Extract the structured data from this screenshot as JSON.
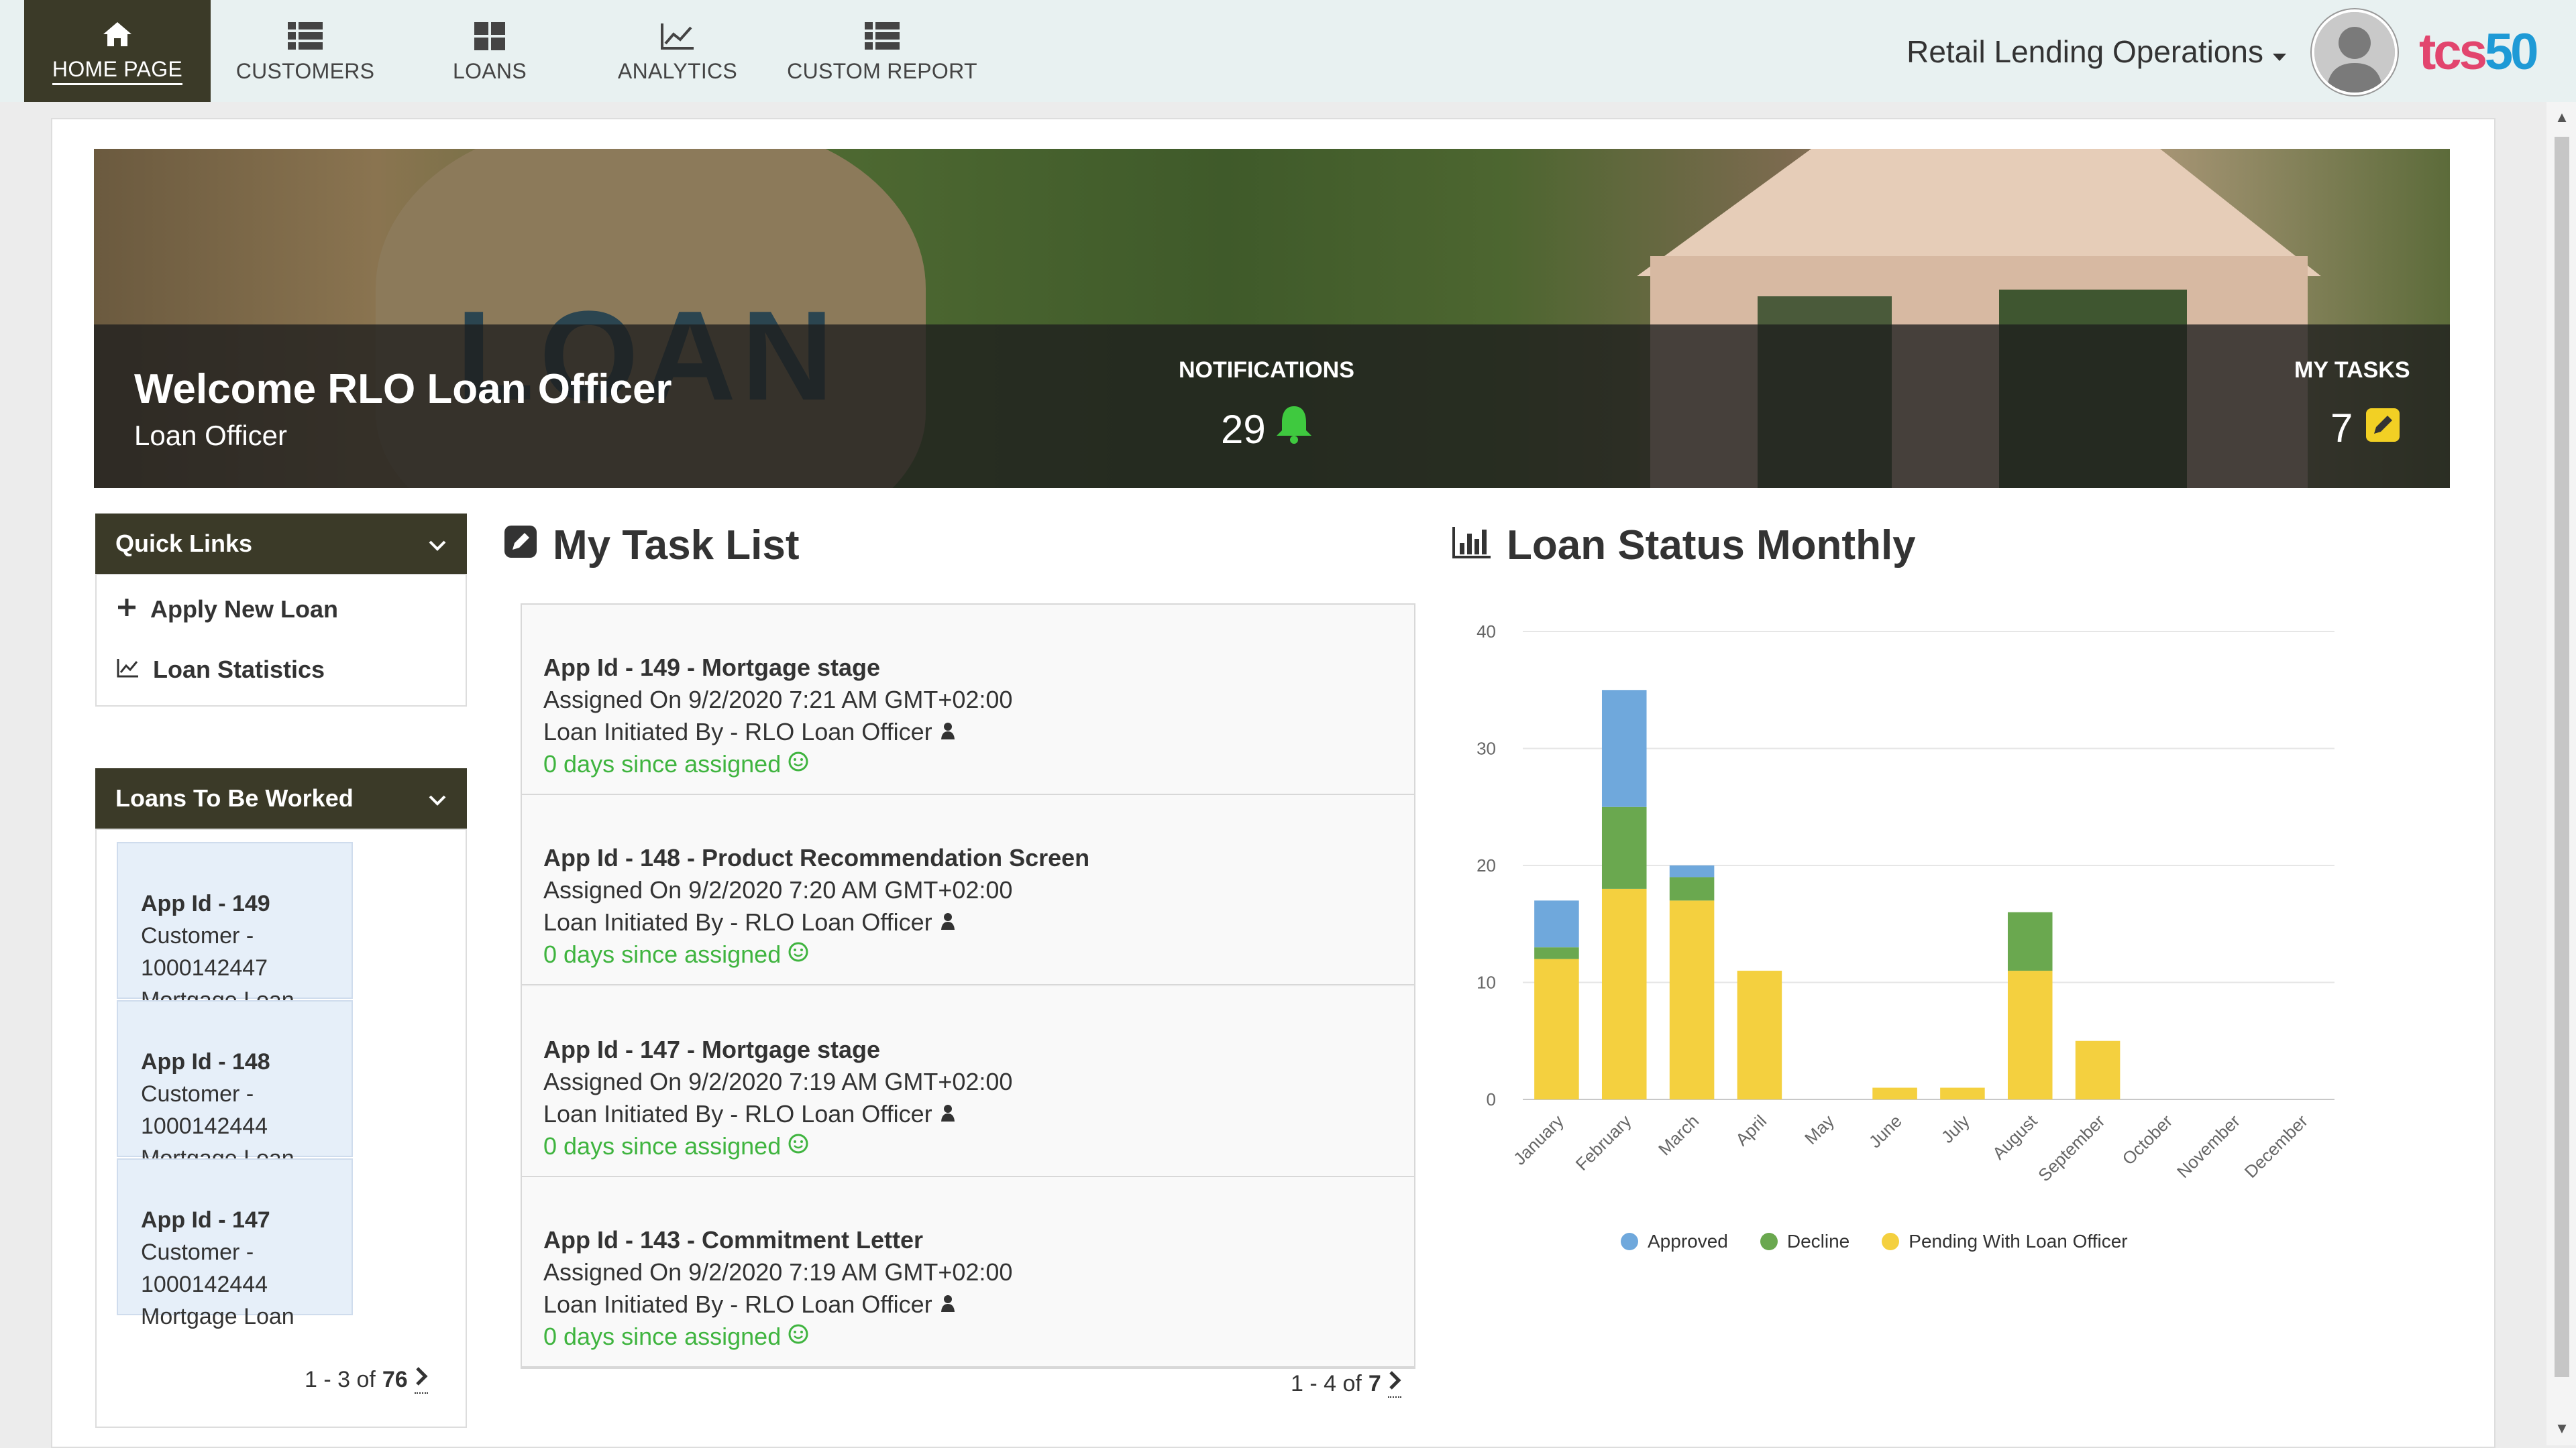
{
  "nav": {
    "items": [
      {
        "label": "HOME PAGE",
        "icon": "home-icon"
      },
      {
        "label": "CUSTOMERS",
        "icon": "list-icon"
      },
      {
        "label": "LOANS",
        "icon": "grid-icon"
      },
      {
        "label": "ANALYTICS",
        "icon": "line-chart-icon"
      },
      {
        "label": "CUSTOM REPORT",
        "icon": "list-icon"
      }
    ],
    "org_selector": "Retail Lending Operations",
    "brand": {
      "part1": "tcs",
      "part2": "50",
      "color1": "#e2456e",
      "color2": "#1e9ad6"
    }
  },
  "hero": {
    "welcome": "Welcome RLO Loan Officer",
    "role": "Loan Officer",
    "notifications_label": "NOTIFICATIONS",
    "notifications_count": "29",
    "tasks_label": "MY TASKS",
    "tasks_count": "7",
    "sack_text": "LOAN"
  },
  "quick_links": {
    "title": "Quick Links",
    "items": [
      {
        "label": "Apply New Loan",
        "icon": "plus-icon"
      },
      {
        "label": "Loan Statistics",
        "icon": "line-chart-icon"
      }
    ]
  },
  "loans_to_work": {
    "title": "Loans To Be Worked",
    "items": [
      {
        "id": "App Id - 149",
        "customer": "Customer - 1000142447",
        "type": "Mortgage Loan"
      },
      {
        "id": "App Id - 148",
        "customer": "Customer - 1000142444",
        "type": "Mortgage Loan"
      },
      {
        "id": "App Id - 147",
        "customer": "Customer - 1000142444",
        "type": "Mortgage Loan"
      }
    ],
    "pager_range": "1 - 3 of",
    "pager_total": "76"
  },
  "task_list": {
    "title": "My Task List",
    "items": [
      {
        "title": "App Id - 149 - Mortgage stage",
        "assigned": "Assigned On 9/2/2020 7:21 AM GMT+02:00",
        "initiated": "Loan Initiated By - RLO Loan Officer",
        "days": "0 days since assigned"
      },
      {
        "title": "App Id - 148 - Product Recommendation Screen",
        "assigned": "Assigned On 9/2/2020 7:20 AM GMT+02:00",
        "initiated": "Loan Initiated By - RLO Loan Officer",
        "days": "0 days since assigned"
      },
      {
        "title": "App Id - 147 - Mortgage stage",
        "assigned": "Assigned On 9/2/2020 7:19 AM GMT+02:00",
        "initiated": "Loan Initiated By - RLO Loan Officer",
        "days": "0 days since assigned"
      },
      {
        "title": "App Id - 143 - Commitment Letter",
        "assigned": "Assigned On 9/2/2020 7:19 AM GMT+02:00",
        "initiated": "Loan Initiated By - RLO Loan Officer",
        "days": "0 days since assigned"
      }
    ],
    "pager_range": "1 - 4 of",
    "pager_total": "7"
  },
  "chart_title": "Loan Status Monthly",
  "chart_data": {
    "type": "bar",
    "stacked": true,
    "categories": [
      "January",
      "February",
      "March",
      "April",
      "May",
      "June",
      "July",
      "August",
      "September",
      "October",
      "November",
      "December"
    ],
    "series": [
      {
        "name": "Pending With Loan Officer",
        "color": "#f4d03f",
        "values": [
          12,
          18,
          17,
          11,
          0,
          1,
          1,
          11,
          5,
          0,
          0,
          0
        ]
      },
      {
        "name": "Decline",
        "color": "#6aa84f",
        "values": [
          1,
          7,
          2,
          0,
          0,
          0,
          0,
          5,
          0,
          0,
          0,
          0
        ]
      },
      {
        "name": "Approved",
        "color": "#6fa8dc",
        "values": [
          4,
          10,
          1,
          0,
          0,
          0,
          0,
          0,
          0,
          0,
          0,
          0
        ]
      }
    ],
    "yticks": [
      "0",
      "10",
      "20",
      "30",
      "40"
    ],
    "ylim": [
      0,
      40
    ],
    "grid": true,
    "legend": "bottom"
  }
}
